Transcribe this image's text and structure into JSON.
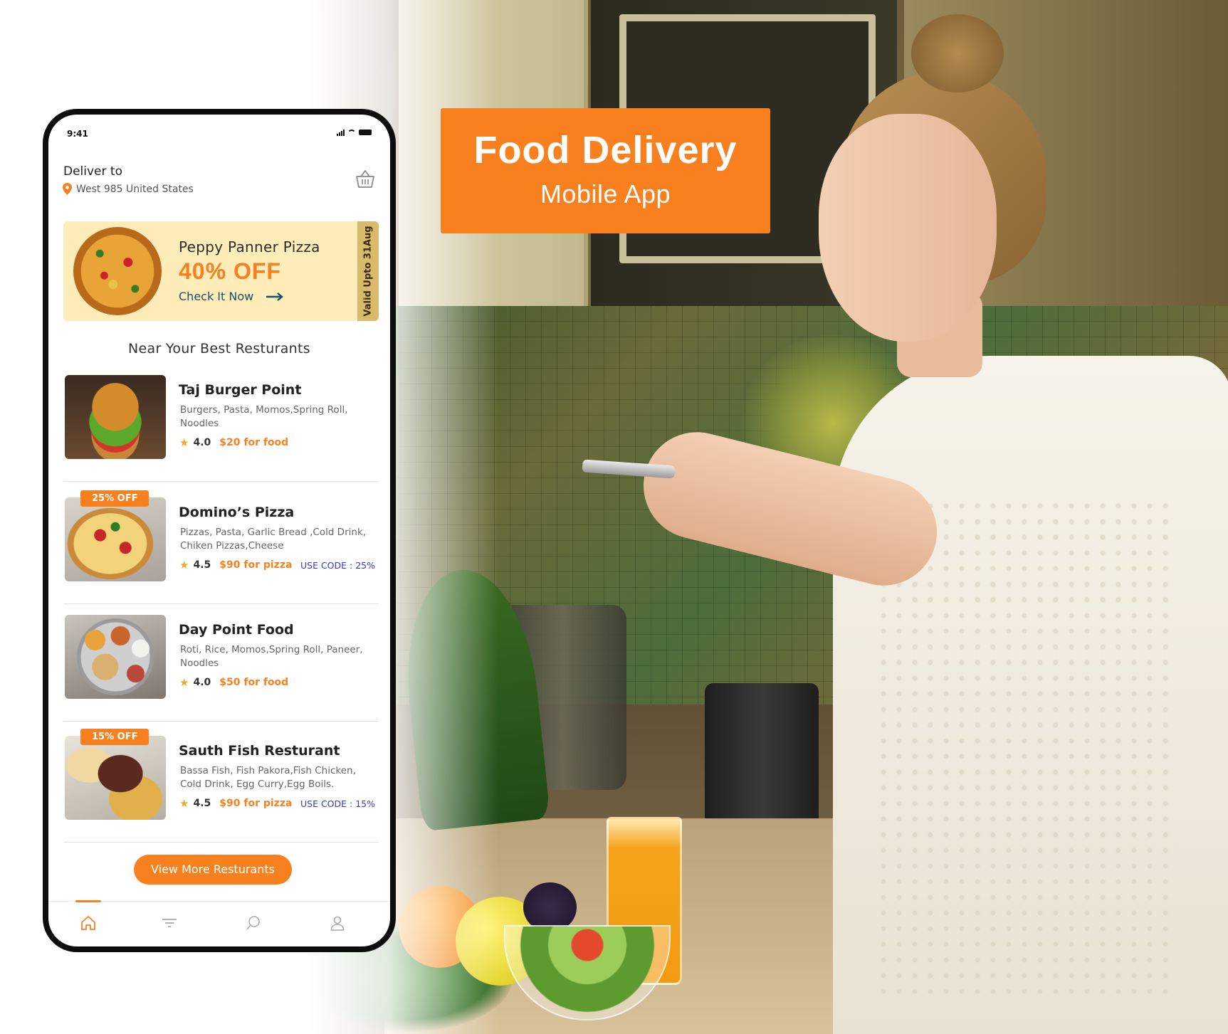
{
  "banner": {
    "title": "Food Delivery",
    "subtitle": "Mobile App"
  },
  "status_bar": {
    "time": "9:41"
  },
  "header": {
    "deliver_label": "Deliver to",
    "location": "West 985 United States"
  },
  "promo": {
    "name": "Peppy Panner Pizza",
    "discount": "40% OFF",
    "cta": "Check It Now",
    "validity": "Valid Upto 31Aug"
  },
  "section_title": "Near Your Best Resturants",
  "restaurants": [
    {
      "name": "Taj Burger Point",
      "cuisine": "Burgers, Pasta, Momos,Spring Roll, Noodles",
      "rating": "4.0",
      "price": "$20 for food",
      "badge": "",
      "code": ""
    },
    {
      "name": "Domino’s Pizza",
      "cuisine": "Pizzas, Pasta, Garlic Bread ,Cold Drink, Chiken Pizzas,Cheese",
      "rating": "4.5",
      "price": "$90 for pizza",
      "badge": "25% OFF",
      "code": "USE CODE : 25%"
    },
    {
      "name": "Day Point Food",
      "cuisine": "Roti, Rice, Momos,Spring Roll, Paneer, Noodles",
      "rating": "4.0",
      "price": "$50 for food",
      "badge": "",
      "code": ""
    },
    {
      "name": "Sauth Fish Resturant",
      "cuisine": "Bassa Fish, Fish Pakora,Fish Chicken, Cold Drink, Egg Curry,Egg Boils.",
      "rating": "4.5",
      "price": "$90 for pizza",
      "badge": "15% OFF",
      "code": "USE CODE : 15%"
    }
  ],
  "view_more": "View More Resturants",
  "tabs": [
    "home-icon",
    "filter-icon",
    "search-icon",
    "profile-icon"
  ],
  "colors": {
    "accent": "#f9801f",
    "promo_bg": "#feedb9",
    "code_text": "#3a3ad0",
    "cta_text": "#1b4f6b"
  }
}
